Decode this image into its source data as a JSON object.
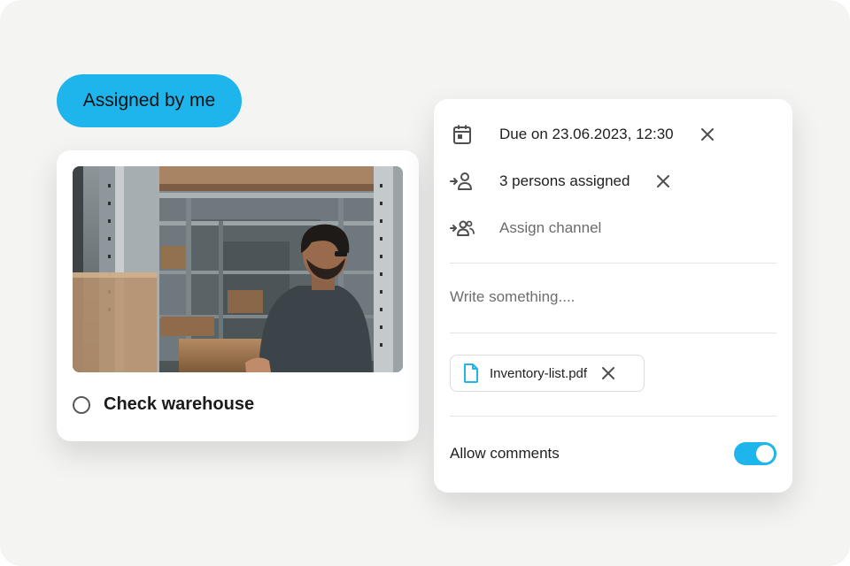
{
  "filter": {
    "label": "Assigned by me"
  },
  "task": {
    "title": "Check warehouse",
    "photo_icon": "warehouse-photo"
  },
  "panel": {
    "due": {
      "icon": "calendar-icon",
      "text": "Due on 23.06.2023, 12:30"
    },
    "assignees": {
      "icon": "person-add-icon",
      "text": "3 persons assigned"
    },
    "channel": {
      "icon": "group-add-icon",
      "text": "Assign channel"
    },
    "comment_placeholder": "Write something....",
    "attachment": {
      "icon": "file-icon",
      "name": "Inventory-list.pdf"
    },
    "allow_comments": {
      "label": "Allow comments",
      "enabled": true
    }
  },
  "colors": {
    "accent": "#1eb4ec",
    "file_icon": "#1eb4ec",
    "background": "#f4f4f2"
  }
}
